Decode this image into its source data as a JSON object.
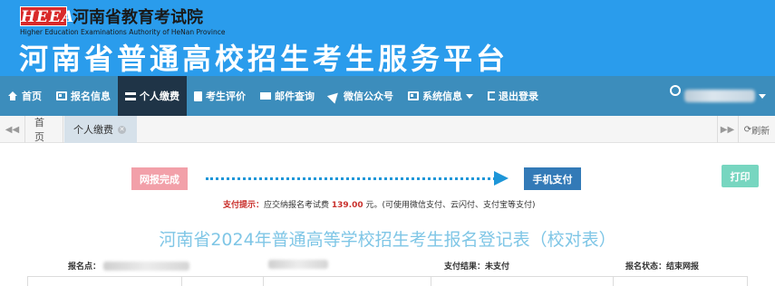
{
  "header": {
    "logo_text": "HEEA",
    "org_name": "河南省教育考试院",
    "org_name_en": "Higher Education Examinations Authority of HeNan Province",
    "platform_title": "河南省普通高校招生考生服务平台"
  },
  "nav": {
    "items": [
      {
        "label": "首页",
        "icon": "home-icon"
      },
      {
        "label": "报名信息",
        "icon": "id-card-icon"
      },
      {
        "label": "个人缴费",
        "icon": "wallet-icon",
        "active": true
      },
      {
        "label": "考生评价",
        "icon": "book-icon"
      },
      {
        "label": "邮件查询",
        "icon": "envelope-icon"
      },
      {
        "label": "微信公众号",
        "icon": "paper-plane-icon"
      },
      {
        "label": "系统信息",
        "icon": "id-card-icon",
        "has_dropdown": true
      },
      {
        "label": "退出登录",
        "icon": "sign-out-icon"
      }
    ]
  },
  "tabs": {
    "home_label": "首页",
    "active_label": "个人缴费",
    "refresh_label": "刷新"
  },
  "steps": {
    "done_label": "网报完成",
    "mobile_pay_label": "手机支付",
    "print_label": "打印"
  },
  "tip": {
    "label": "支付提示：",
    "text_before": "应交纳报名考试费",
    "amount": "139.00",
    "text_after": "元。(可使用微信支付、云闪付、支付宝等支付)"
  },
  "form": {
    "title": "河南省2024年普通高等学校招生考生报名登记表（校对表）",
    "site_label": "报名点：",
    "payment_result_label": "支付结果：",
    "payment_result_value": "未支付",
    "status_label": "报名状态：",
    "status_value": "结束网报"
  },
  "colors": {
    "banner_bg": "#2a9cec",
    "nav_bg": "#3c8dbc",
    "nav_active_bg": "#1f3447",
    "step_done": "#f2a0a9",
    "step_current": "#337ab7",
    "print_btn": "#77d6c0",
    "title_color": "#7fc6e6",
    "tip_red": "#c9302c"
  }
}
